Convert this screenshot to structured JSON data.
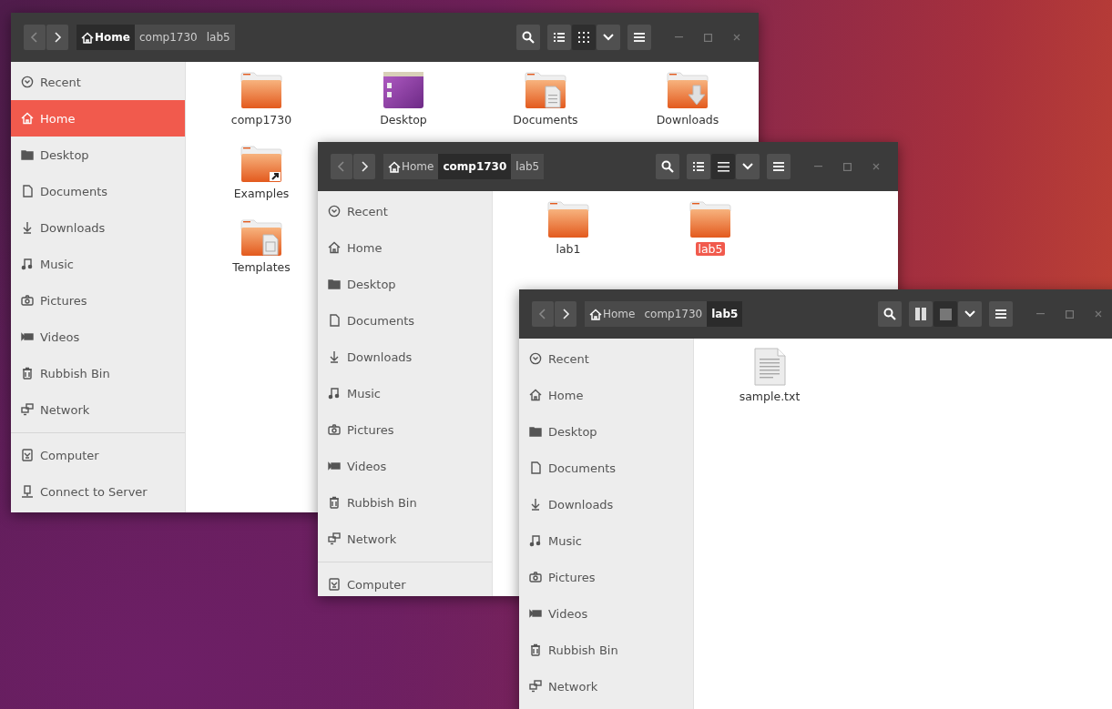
{
  "windows": [
    {
      "breadcrumbs": [
        {
          "label": "Home",
          "kind": "home",
          "selected": true
        },
        {
          "label": "comp1730",
          "kind": "plain",
          "selected": false
        },
        {
          "label": "lab5",
          "kind": "plain",
          "selected": false
        }
      ],
      "view_buttons": [
        {
          "kind": "bullets",
          "selected": false
        },
        {
          "kind": "grid",
          "selected": true
        }
      ],
      "sidebar": {
        "places": [
          {
            "label": "Recent",
            "kind": "recent",
            "selected": false
          },
          {
            "label": "Home",
            "kind": "home",
            "selected": true
          },
          {
            "label": "Desktop",
            "kind": "desktop",
            "selected": false
          },
          {
            "label": "Documents",
            "kind": "documents",
            "selected": false
          },
          {
            "label": "Downloads",
            "kind": "downloads",
            "selected": false
          },
          {
            "label": "Music",
            "kind": "music",
            "selected": false
          },
          {
            "label": "Pictures",
            "kind": "pictures",
            "selected": false
          },
          {
            "label": "Videos",
            "kind": "videos",
            "selected": false
          },
          {
            "label": "Rubbish Bin",
            "kind": "bin",
            "selected": false
          },
          {
            "label": "Network",
            "kind": "network",
            "selected": false
          }
        ],
        "devices": [
          {
            "label": "Computer",
            "kind": "computer",
            "selected": false
          },
          {
            "label": "Connect to Server",
            "kind": "server",
            "selected": false
          }
        ]
      },
      "file_rows": [
        [
          {
            "label": "comp1730",
            "kind": "folder",
            "selected": false
          },
          {
            "label": "Desktop",
            "kind": "desktop-folder",
            "selected": false
          },
          {
            "label": "Documents",
            "kind": "documents-folder",
            "selected": false
          },
          {
            "label": "Downloads",
            "kind": "downloads-folder",
            "selected": false
          }
        ],
        [
          {
            "label": "Examples",
            "kind": "link-folder",
            "selected": false
          }
        ],
        [
          {
            "label": "Templates",
            "kind": "templates-folder",
            "selected": false
          }
        ]
      ]
    },
    {
      "breadcrumbs": [
        {
          "label": "Home",
          "kind": "home",
          "selected": false
        },
        {
          "label": "comp1730",
          "kind": "plain",
          "selected": true
        },
        {
          "label": "lab5",
          "kind": "plain",
          "selected": false
        }
      ],
      "view_buttons": [
        {
          "kind": "bullets",
          "selected": false
        },
        {
          "kind": "lines",
          "selected": true
        }
      ],
      "sidebar": {
        "places": [
          {
            "label": "Recent",
            "kind": "recent",
            "selected": false
          },
          {
            "label": "Home",
            "kind": "home",
            "selected": false
          },
          {
            "label": "Desktop",
            "kind": "desktop",
            "selected": false
          },
          {
            "label": "Documents",
            "kind": "documents",
            "selected": false
          },
          {
            "label": "Downloads",
            "kind": "downloads",
            "selected": false
          },
          {
            "label": "Music",
            "kind": "music",
            "selected": false
          },
          {
            "label": "Pictures",
            "kind": "pictures",
            "selected": false
          },
          {
            "label": "Videos",
            "kind": "videos",
            "selected": false
          },
          {
            "label": "Rubbish Bin",
            "kind": "bin",
            "selected": false
          },
          {
            "label": "Network",
            "kind": "network",
            "selected": false
          }
        ],
        "devices": [
          {
            "label": "Computer",
            "kind": "computer",
            "selected": false
          }
        ]
      },
      "file_rows": [
        [
          {
            "label": "lab1",
            "kind": "folder",
            "selected": false
          },
          {
            "label": "lab5",
            "kind": "folder",
            "selected": true
          }
        ]
      ]
    },
    {
      "breadcrumbs": [
        {
          "label": "Home",
          "kind": "home",
          "selected": false
        },
        {
          "label": "comp1730",
          "kind": "plain",
          "selected": false
        },
        {
          "label": "lab5",
          "kind": "plain",
          "selected": true
        }
      ],
      "view_buttons": [
        {
          "kind": "bars",
          "selected": false
        },
        {
          "kind": "square",
          "selected": true
        }
      ],
      "sidebar": {
        "places": [
          {
            "label": "Recent",
            "kind": "recent",
            "selected": false
          },
          {
            "label": "Home",
            "kind": "home",
            "selected": false
          },
          {
            "label": "Desktop",
            "kind": "desktop",
            "selected": false
          },
          {
            "label": "Documents",
            "kind": "documents",
            "selected": false
          },
          {
            "label": "Downloads",
            "kind": "downloads",
            "selected": false
          },
          {
            "label": "Music",
            "kind": "music",
            "selected": false
          },
          {
            "label": "Pictures",
            "kind": "pictures",
            "selected": false
          },
          {
            "label": "Videos",
            "kind": "videos",
            "selected": false
          },
          {
            "label": "Rubbish Bin",
            "kind": "bin",
            "selected": false
          },
          {
            "label": "Network",
            "kind": "network",
            "selected": false
          }
        ]
      },
      "file_rows": [
        [
          {
            "label": "sample.txt",
            "kind": "text-file",
            "selected": false
          }
        ]
      ]
    }
  ]
}
